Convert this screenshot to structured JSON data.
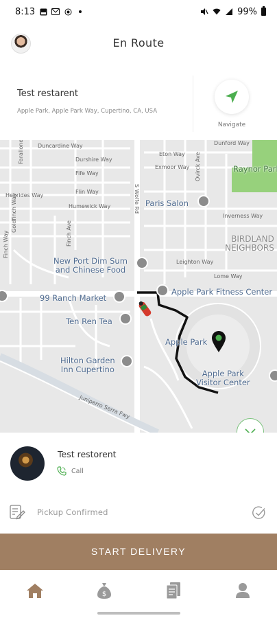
{
  "status_bar": {
    "time": "8:13",
    "battery": "99%",
    "left_icons": [
      "photo-icon",
      "mail-icon",
      "record-icon",
      "dot-icon"
    ],
    "right_icons": [
      "mute-icon",
      "wifi-icon",
      "signal-icon",
      "battery-icon"
    ]
  },
  "header": {
    "title": "En Route"
  },
  "restaurant": {
    "name": "Test restarent",
    "address": "Apple Park, Apple Park Way, Cupertino, CA, USA",
    "navigate_label": "Navigate"
  },
  "map": {
    "streets": [
      "Duncardine Way",
      "Durshire Way",
      "Fife Way",
      "Hebrides Way",
      "Flin Way",
      "Humewick Way",
      "Eton Way",
      "Exmoor Way",
      "Dunford Way",
      "Inverness Way",
      "Leighton Way",
      "Lome Way",
      "Goldfinch Way",
      "Finch Ave",
      "Farallone Dr",
      "Ovirck Ave",
      "S Wolfe Rd",
      "Juniperro Serra Fwy",
      "Finch Way"
    ],
    "places": {
      "raynor_park": "Raynor Park",
      "paris_salon": "Paris Salon",
      "birdland": "BIRDLAND\nNEIGHBORS",
      "new_port": "New Port Dim Sum\nand Chinese Food",
      "apple_fitness": "Apple Park Fitness Center",
      "ranch_market": "99 Ranch Market",
      "ten_ren": "Ten Ren Tea",
      "apple_park": "Apple Park",
      "hilton": "Hilton Garden\nInn Cupertino",
      "visitor_center": "Apple Park\nVisitor Center"
    }
  },
  "customer": {
    "name": "Test restorent",
    "call_label": "Call"
  },
  "pickup": {
    "label": "Pickup Confirmed"
  },
  "start_button": {
    "label": "START DELIVERY"
  },
  "bottom_nav": [
    "home-icon",
    "money-bag-icon",
    "orders-icon",
    "profile-icon"
  ],
  "colors": {
    "accent": "#a07f62",
    "green": "#4cae4f",
    "map_bg": "#e8e8e8",
    "poi_text": "#4e6a8f"
  }
}
